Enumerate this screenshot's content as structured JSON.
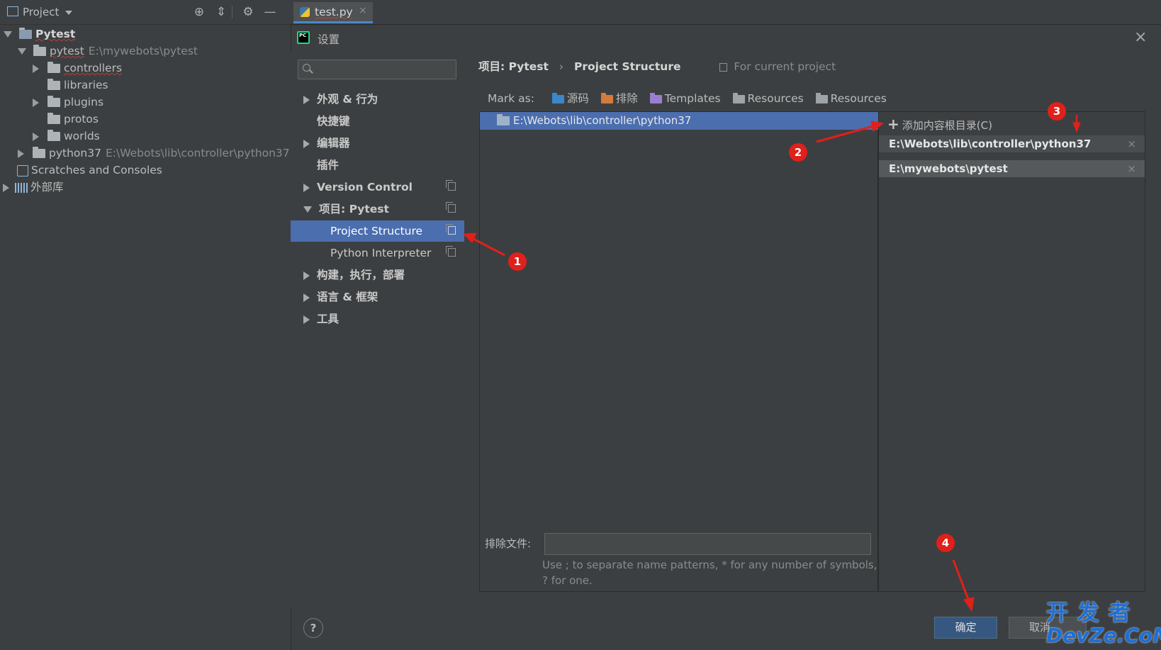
{
  "project_panel": {
    "title": "Project",
    "tree": [
      {
        "label": "Pytest",
        "path": ""
      },
      {
        "label": "pytest",
        "path": "E:\\mywebots\\pytest"
      },
      {
        "label": "controllers",
        "path": ""
      },
      {
        "label": "libraries",
        "path": ""
      },
      {
        "label": "plugins",
        "path": ""
      },
      {
        "label": "protos",
        "path": ""
      },
      {
        "label": "worlds",
        "path": ""
      },
      {
        "label": "python37",
        "path": "E:\\Webots\\lib\\controller\\python37"
      },
      {
        "label": "Scratches and Consoles",
        "path": ""
      },
      {
        "label": "外部库",
        "path": ""
      }
    ]
  },
  "editor": {
    "tab_label": "test.py"
  },
  "dialog": {
    "title": "设置",
    "settings_tree": [
      {
        "label": "外观 & 行为"
      },
      {
        "label": "快捷键"
      },
      {
        "label": "编辑器"
      },
      {
        "label": "插件"
      },
      {
        "label": "Version Control"
      },
      {
        "label": "项目: Pytest"
      },
      {
        "label": "Project Structure"
      },
      {
        "label": "Python Interpreter"
      },
      {
        "label": "构建，执行，部署"
      },
      {
        "label": "语言 & 框架"
      },
      {
        "label": "工具"
      }
    ],
    "breadcrumb": {
      "project": "项目: Pytest",
      "separator": "›",
      "page": "Project Structure",
      "scope": "For current project"
    },
    "mark_as": {
      "label": "Mark as:",
      "items": [
        "源码",
        "排除",
        "Templates",
        "Resources",
        "Resources"
      ]
    },
    "selected_root": "E:\\Webots\\lib\\controller\\python37",
    "add_root_label": "添加内容根目录(C)",
    "content_roots": [
      "E:\\Webots\\lib\\controller\\python37",
      "E:\\mywebots\\pytest"
    ],
    "exclude_label": "排除文件:",
    "exclude_value": "",
    "exclude_hint": "Use ; to separate name patterns, * for any number of symbols, ? for one.",
    "help_label": "?",
    "ok_label": "确定",
    "cancel_label": "取消"
  },
  "annotations": [
    "1",
    "2",
    "3",
    "4"
  ],
  "watermark": {
    "line1": "开 发 者",
    "line2": "DevZe.CoM"
  },
  "colors": {
    "background": "#3c3f41",
    "selection": "#4b6eaf",
    "accent_red": "#e0201b",
    "ok_button": "#365880"
  }
}
